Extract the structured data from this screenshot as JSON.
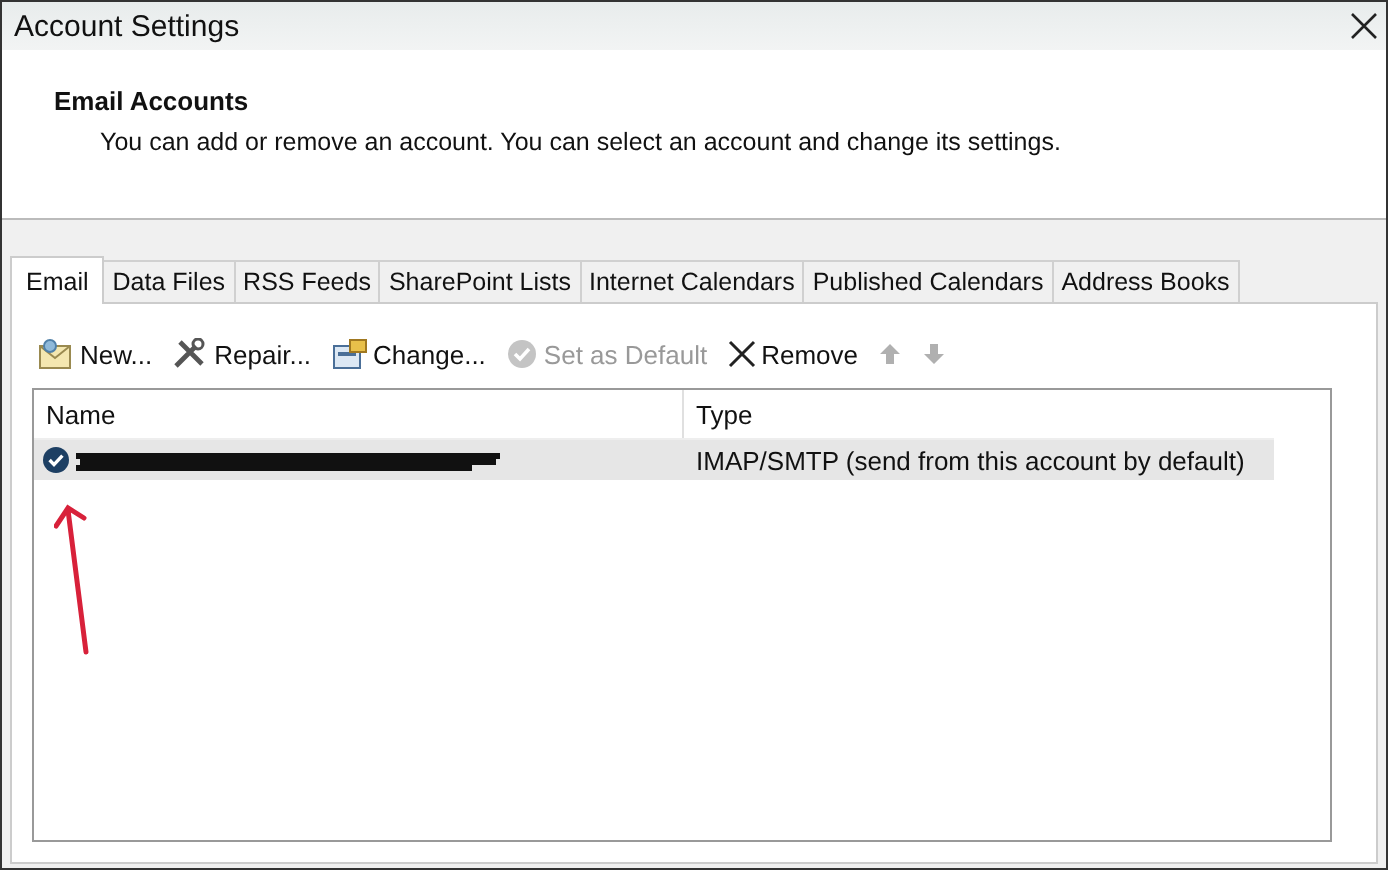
{
  "window": {
    "title": "Account Settings"
  },
  "header": {
    "title": "Email Accounts",
    "description": "You can add or remove an account. You can select an account and change its settings."
  },
  "tabs": [
    {
      "label": "Email",
      "selected": true
    },
    {
      "label": "Data Files",
      "selected": false
    },
    {
      "label": "RSS Feeds",
      "selected": false
    },
    {
      "label": "SharePoint Lists",
      "selected": false
    },
    {
      "label": "Internet Calendars",
      "selected": false
    },
    {
      "label": "Published Calendars",
      "selected": false
    },
    {
      "label": "Address Books",
      "selected": false
    }
  ],
  "toolbar": [
    {
      "kind": "new",
      "label": "New...",
      "disabled": false
    },
    {
      "kind": "repair",
      "label": "Repair...",
      "disabled": false
    },
    {
      "kind": "change",
      "label": "Change...",
      "disabled": false
    },
    {
      "kind": "default",
      "label": "Set as Default",
      "disabled": true
    },
    {
      "kind": "remove",
      "label": "Remove",
      "disabled": false
    },
    {
      "kind": "up",
      "disabled": true
    },
    {
      "kind": "down",
      "disabled": true
    }
  ],
  "table": {
    "columns": [
      "Name",
      "Type"
    ],
    "rows": [
      {
        "default": true,
        "name_redacted": true,
        "type": "IMAP/SMTP (send from this account by default)",
        "selected": true
      }
    ]
  }
}
